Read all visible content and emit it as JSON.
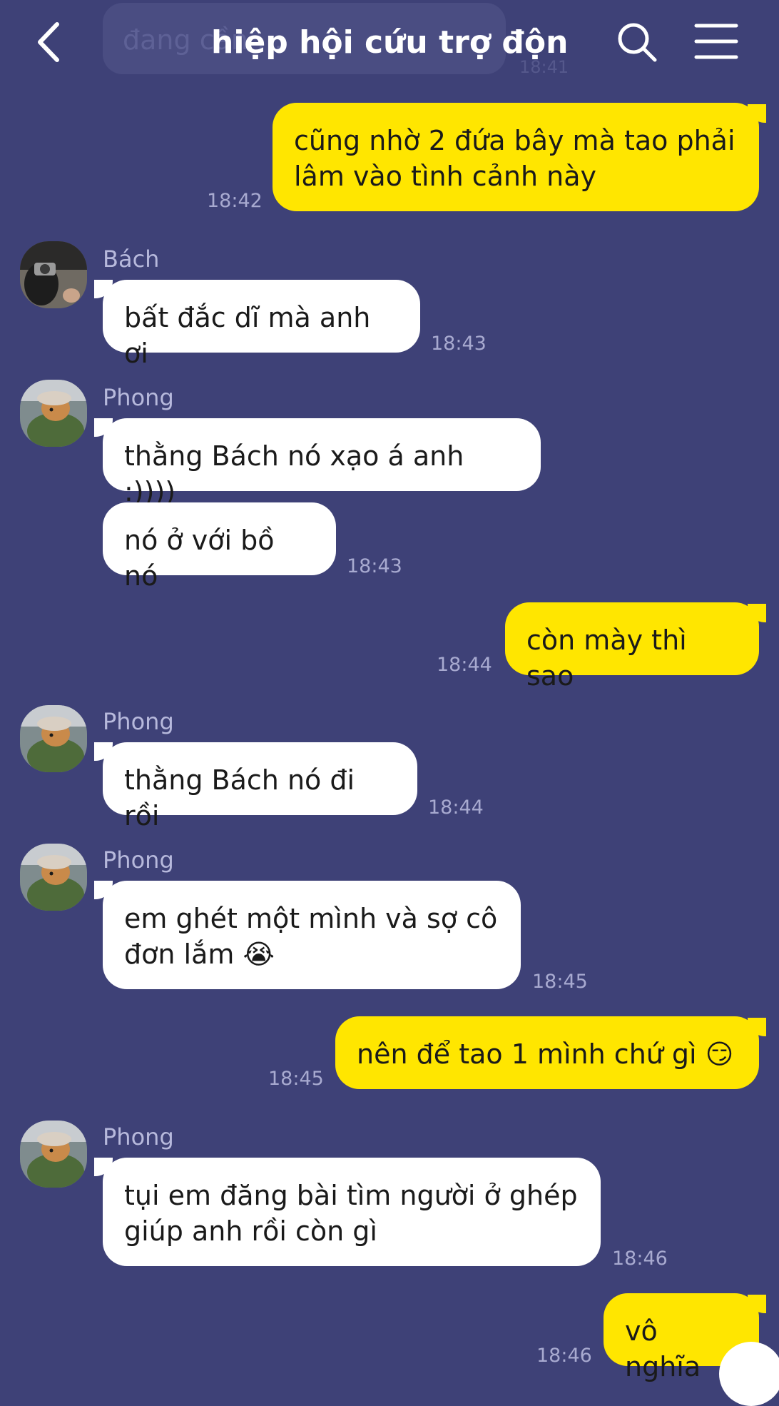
{
  "header": {
    "title": "hiệp hội cứu trợ động v",
    "ghost_text": "đang cần ...",
    "ghost_time": "18:41"
  },
  "messages": {
    "m1": {
      "text": "cũng nhờ 2 đứa bây mà tao phải\nlâm vào tình cảnh này",
      "time": "18:42"
    },
    "m2": {
      "sender": "Bách",
      "text": "bất đắc dĩ mà anh ơi",
      "time": "18:43"
    },
    "m3": {
      "sender": "Phong",
      "text": "thằng Bách nó xạo á anh :))))"
    },
    "m4": {
      "text": "nó ở với bồ nó",
      "time": "18:43"
    },
    "m5": {
      "text": "còn mày thì sao",
      "time": "18:44"
    },
    "m6": {
      "sender": "Phong",
      "text": "thằng Bách nó đi rồi",
      "time": "18:44"
    },
    "m7": {
      "sender": "Phong",
      "text": "em ghét một mình và sợ cô\nđơn lắm 😭",
      "time": "18:45"
    },
    "m8": {
      "text": "nên để tao 1 mình chứ gì 😏",
      "time": "18:45"
    },
    "m9": {
      "sender": "Phong",
      "text": "tụi em đăng bài tìm người ở ghép\ngiúp anh rồi còn gì",
      "time": "18:46"
    },
    "m10": {
      "text": "vô nghĩa",
      "time": "18:46"
    }
  },
  "colors": {
    "background": "#3e4177",
    "outgoing": "#ffe600",
    "incoming": "#ffffff"
  },
  "icons": {
    "back": "chevron-left-icon",
    "search": "search-icon",
    "menu": "hamburger-menu-icon"
  }
}
